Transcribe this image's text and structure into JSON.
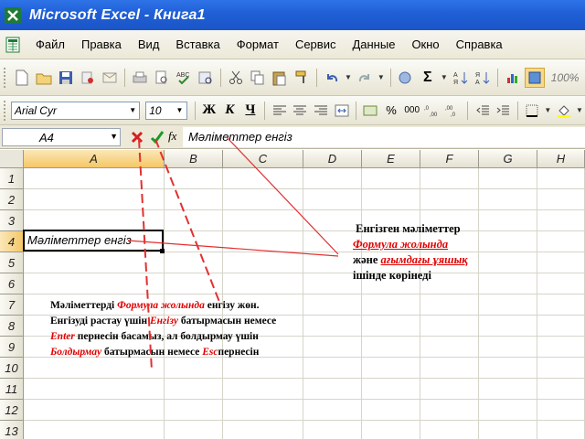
{
  "window": {
    "title": "Microsoft Excel - Книга1"
  },
  "menu": {
    "items": [
      "Файл",
      "Правка",
      "Вид",
      "Вставка",
      "Формат",
      "Сервис",
      "Данные",
      "Окно",
      "Справка"
    ]
  },
  "toolbar": {
    "zoom": "100%",
    "font_name": "Arial Cyr",
    "font_size": "10",
    "bold_label": "Ж",
    "italic_label": "К",
    "underline_label": "Ч",
    "sigma_label": "Σ",
    "percent_label": "%",
    "thousands_label": "000"
  },
  "formula_bar": {
    "name_box": "A4",
    "fx_label": "fx",
    "content": "Мәліметтер енгіз"
  },
  "sheet": {
    "columns": [
      "A",
      "B",
      "C",
      "D",
      "E",
      "F",
      "G",
      "H"
    ],
    "active_column": "A",
    "rows": [
      "1",
      "2",
      "3",
      "4",
      "5",
      "6",
      "7",
      "8",
      "9",
      "10",
      "11",
      "12",
      "13"
    ],
    "active_row": "4",
    "active_cell_text": "Мәліметтер енгіз"
  },
  "annotations": {
    "right": {
      "l1": "Енгізген мәліметтер",
      "l2_red": "Формула жолында",
      "l3_a": "және ",
      "l3_red": "ағымдағы ұяшық",
      "l4": "ішінде көрінеді"
    },
    "left": {
      "p1": "Мәліметтерді ",
      "p1_red": "Формула жолында",
      "p1_b": " енгізу жөн.",
      "p2": "Енгізуді растау үшін ",
      "p2_red": "Енгізу",
      "p2_b": " батырмасын немесе",
      "p3_red": "Enter",
      "p3_b": " пернесін басамыз, ал болдырмау үшін",
      "p4_red": "Болдырмау",
      "p4_b": " батырмасын немесе ",
      "p4_red2": "Esc",
      "p4_c": "пернесін"
    }
  },
  "colors": {
    "title_bar": "#1f5fd6",
    "annotation_red": "#e00000",
    "active_header": "#f5c766"
  }
}
